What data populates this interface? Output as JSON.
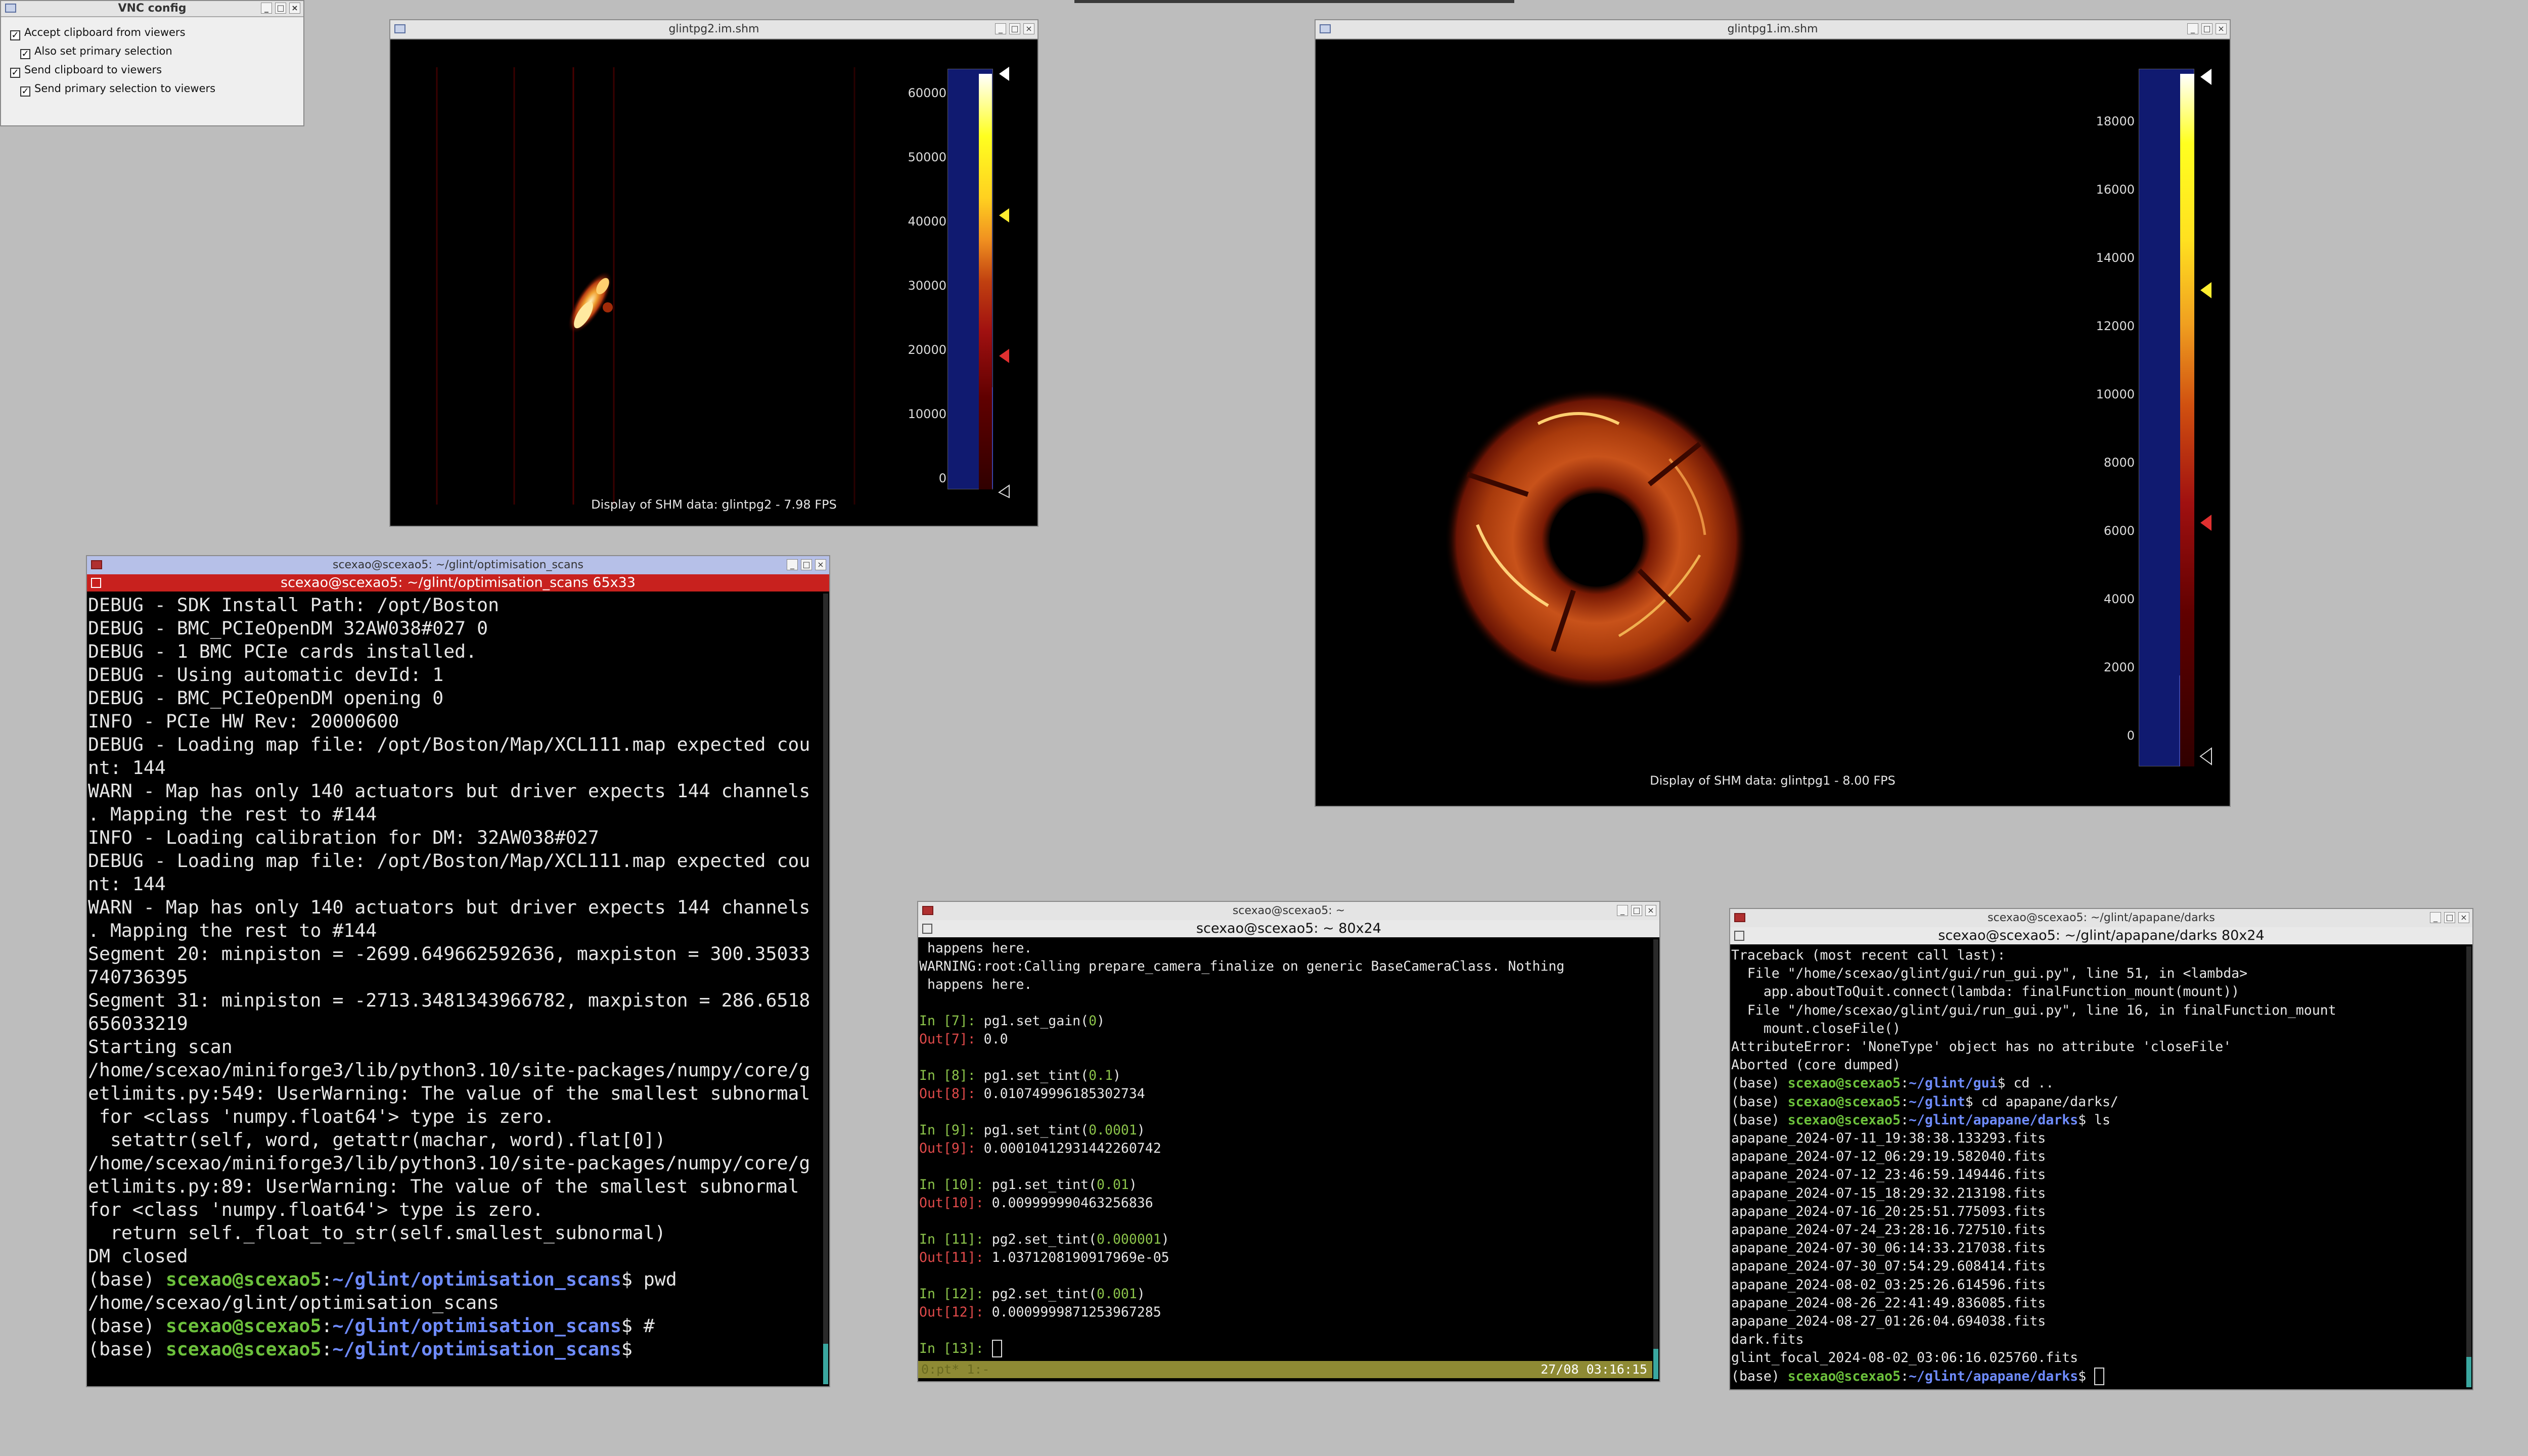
{
  "vnc": {
    "title": "VNC config",
    "options": [
      {
        "label": "Accept clipboard from viewers",
        "checked": true
      },
      {
        "label": "Also set primary selection",
        "checked": true
      },
      {
        "label": "Send clipboard to viewers",
        "checked": true
      },
      {
        "label": "Send primary selection to viewers",
        "checked": true
      }
    ]
  },
  "pg2": {
    "title": "glintpg2.im.shm",
    "caption": "Display of SHM data: glintpg2 - 7.98 FPS",
    "ticks": [
      "60000",
      "50000",
      "40000",
      "30000",
      "20000",
      "10000",
      "0"
    ]
  },
  "pg1": {
    "title": "glintpg1.im.shm",
    "caption": "Display of SHM data: glintpg1 - 8.00 FPS",
    "ticks": [
      "18000",
      "16000",
      "14000",
      "12000",
      "10000",
      "8000",
      "6000",
      "4000",
      "2000",
      "0"
    ]
  },
  "term1": {
    "title": "scexao@scexao5: ~/glint/optimisation_scans",
    "subtitle": "scexao@scexao5: ~/glint/optimisation_scans 65x33",
    "lines": [
      "DEBUG - SDK Install Path: /opt/Boston",
      "DEBUG - BMC_PCIeOpenDM 32AW038#027 0",
      "DEBUG - 1 BMC PCIe cards installed.",
      "DEBUG - Using automatic devId: 1",
      "DEBUG - BMC_PCIeOpenDM opening 0",
      "INFO - PCIe HW Rev: 20000600",
      "DEBUG - Loading map file: /opt/Boston/Map/XCL111.map expected cou",
      "nt: 144",
      "WARN - Map has only 140 actuators but driver expects 144 channels",
      ". Mapping the rest to #144",
      "INFO - Loading calibration for DM: 32AW038#027",
      "DEBUG - Loading map file: /opt/Boston/Map/XCL111.map expected cou",
      "nt: 144",
      "WARN - Map has only 140 actuators but driver expects 144 channels",
      ". Mapping the rest to #144",
      "Segment 20: minpiston = -2699.649662592636, maxpiston = 300.35033",
      "740736395",
      "Segment 31: minpiston = -2713.3481343966782, maxpiston = 286.6518",
      "656033219",
      "Starting scan",
      "/home/scexao/miniforge3/lib/python3.10/site-packages/numpy/core/g",
      "etlimits.py:549: UserWarning: The value of the smallest subnormal",
      " for <class 'numpy.float64'> type is zero.",
      "  setattr(self, word, getattr(machar, word).flat[0])",
      "/home/scexao/miniforge3/lib/python3.10/site-packages/numpy/core/g",
      "etlimits.py:89: UserWarning: The value of the smallest subnormal",
      "for <class 'numpy.float64'> type is zero.",
      "  return self._float_to_str(self.smallest_subnormal)",
      "DM closed"
    ],
    "prompts": [
      {
        "user": "scexao@scexao5",
        "path": "~/glint/optimisation_scans",
        "cmd": " pwd"
      },
      {
        "output": "/home/scexao/glint/optimisation_scans"
      },
      {
        "user": "scexao@scexao5",
        "path": "~/glint/optimisation_scans",
        "cmd": " #"
      },
      {
        "user": "scexao@scexao5",
        "path": "~/glint/optimisation_scans",
        "cmd": ""
      }
    ],
    "env": "(base) "
  },
  "term2": {
    "title": "scexao@scexao5: ~",
    "subtitle": "scexao@scexao5: ~ 80x24",
    "pre": [
      " happens here.",
      "WARNING:root:Calling prepare_camera_finalize on generic BaseCameraClass. Nothing",
      " happens here."
    ],
    "cells": [
      {
        "n": "7",
        "pre": "pg1.set_gain(",
        "arg": "0",
        "post": ")",
        "out": "0.0"
      },
      {
        "n": "8",
        "pre": "pg1.set_tint(",
        "arg": "0.1",
        "post": ")",
        "out": "0.010749996185302734"
      },
      {
        "n": "9",
        "pre": "pg1.set_tint(",
        "arg": "0.0001",
        "post": ")",
        "out": "0.00010412931442260742"
      },
      {
        "n": "10",
        "pre": "pg1.set_tint(",
        "arg": "0.01",
        "post": ")",
        "out": "0.009999990463256836"
      },
      {
        "n": "11",
        "pre": "pg2.set_tint(",
        "arg": "0.000001",
        "post": ")",
        "out": "1.0371208190917969e-05"
      },
      {
        "n": "12",
        "pre": "pg2.set_tint(",
        "arg": "0.001",
        "post": ")",
        "out": "0.0009999871253967285"
      }
    ],
    "last_in": "13",
    "status_left": "0:pt*  1:-",
    "status_right": "27/08  03:16:15"
  },
  "term3": {
    "title": "scexao@scexao5: ~/glint/apapane/darks",
    "subtitle": "scexao@scexao5: ~/glint/apapane/darks 80x24",
    "lines": [
      "Traceback (most recent call last):",
      "  File \"/home/scexao/glint/gui/run_gui.py\", line 51, in <lambda>",
      "    app.aboutToQuit.connect(lambda: finalFunction_mount(mount))",
      "  File \"/home/scexao/glint/gui/run_gui.py\", line 16, in finalFunction_mount",
      "    mount.closeFile()",
      "AttributeError: 'NoneType' object has no attribute 'closeFile'",
      "Aborted (core dumped)"
    ],
    "prompts": [
      {
        "path": "~/glint/gui",
        "cmd": " cd .."
      },
      {
        "path": "~/glint",
        "cmd": " cd apapane/darks/"
      },
      {
        "path": "~/glint/apapane/darks",
        "cmd": " ls"
      }
    ],
    "files": [
      "apapane_2024-07-11_19:38:38.133293.fits",
      "apapane_2024-07-12_06:29:19.582040.fits",
      "apapane_2024-07-12_23:46:59.149446.fits",
      "apapane_2024-07-15_18:29:32.213198.fits",
      "apapane_2024-07-16_20:25:51.775093.fits",
      "apapane_2024-07-24_23:28:16.727510.fits",
      "apapane_2024-07-30_06:14:33.217038.fits",
      "apapane_2024-07-30_07:54:29.608414.fits",
      "apapane_2024-08-02_03:25:26.614596.fits",
      "apapane_2024-08-26_22:41:49.836085.fits",
      "apapane_2024-08-27_01:26:04.694038.fits",
      "dark.fits",
      "glint_focal_2024-08-02_03:06:16.025760.fits"
    ],
    "final_path": "~/glint/apapane/darks",
    "user": "scexao@scexao5",
    "env": "(base) "
  },
  "colors": {
    "prompt_user": "#6cc13c",
    "prompt_path": "#6f8cff",
    "term_red": "#c8211e"
  }
}
